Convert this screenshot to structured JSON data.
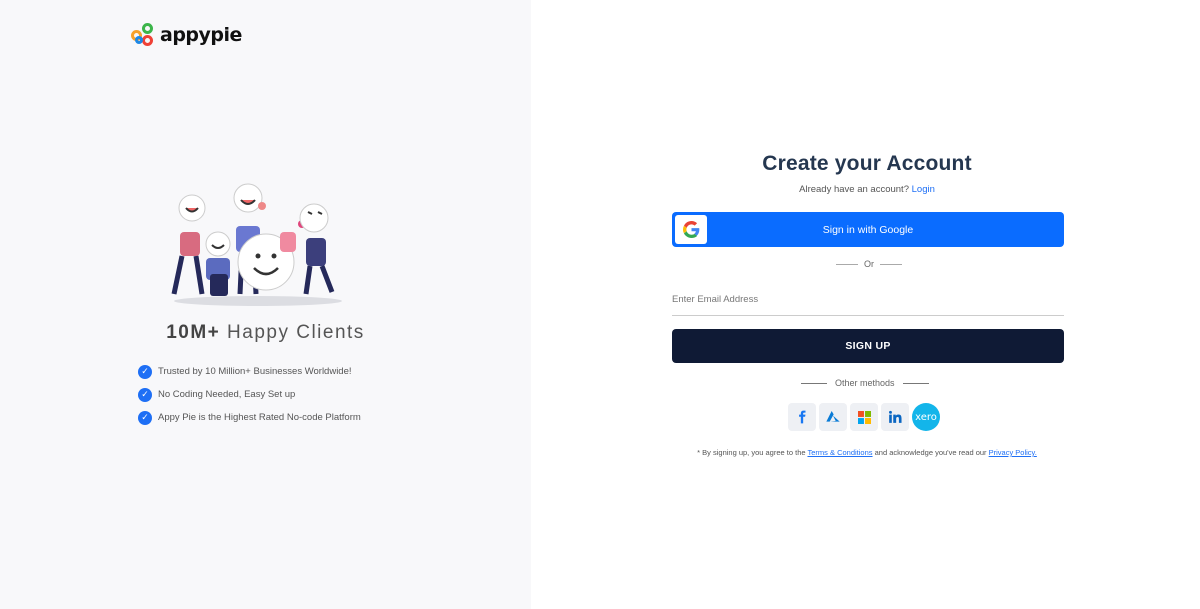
{
  "brand": {
    "name": "appypie"
  },
  "left_panel": {
    "headline_bold": "10M+",
    "headline_rest": " Happy Clients",
    "features": [
      "Trusted by 10 Million+ Businesses Worldwide!",
      "No Coding Needed, Easy Set up",
      "Appy Pie is the Highest Rated No-code Platform"
    ]
  },
  "form": {
    "title": "Create your Account",
    "already_text": "Already have an account?",
    "login_link": "Login",
    "google_button": "Sign in with Google",
    "or_text": "Or",
    "email_placeholder": "Enter Email Address",
    "signup_button": "SIGN UP",
    "other_methods": "Other methods",
    "social_icons": [
      "facebook-icon",
      "azure-icon",
      "microsoft-icon",
      "linkedin-icon",
      "xero-icon"
    ],
    "xero_label": "xero",
    "terms_prefix": "* By signing up, you agree to the ",
    "terms_link": "Terms & Conditions",
    "terms_middle": " and acknowledge you've read our ",
    "privacy_link": "Privacy Policy."
  },
  "colors": {
    "primary_blue": "#0a6cff",
    "dark_navy": "#0f1a35",
    "title_color": "#253750",
    "left_bg": "#f8f8fa"
  }
}
